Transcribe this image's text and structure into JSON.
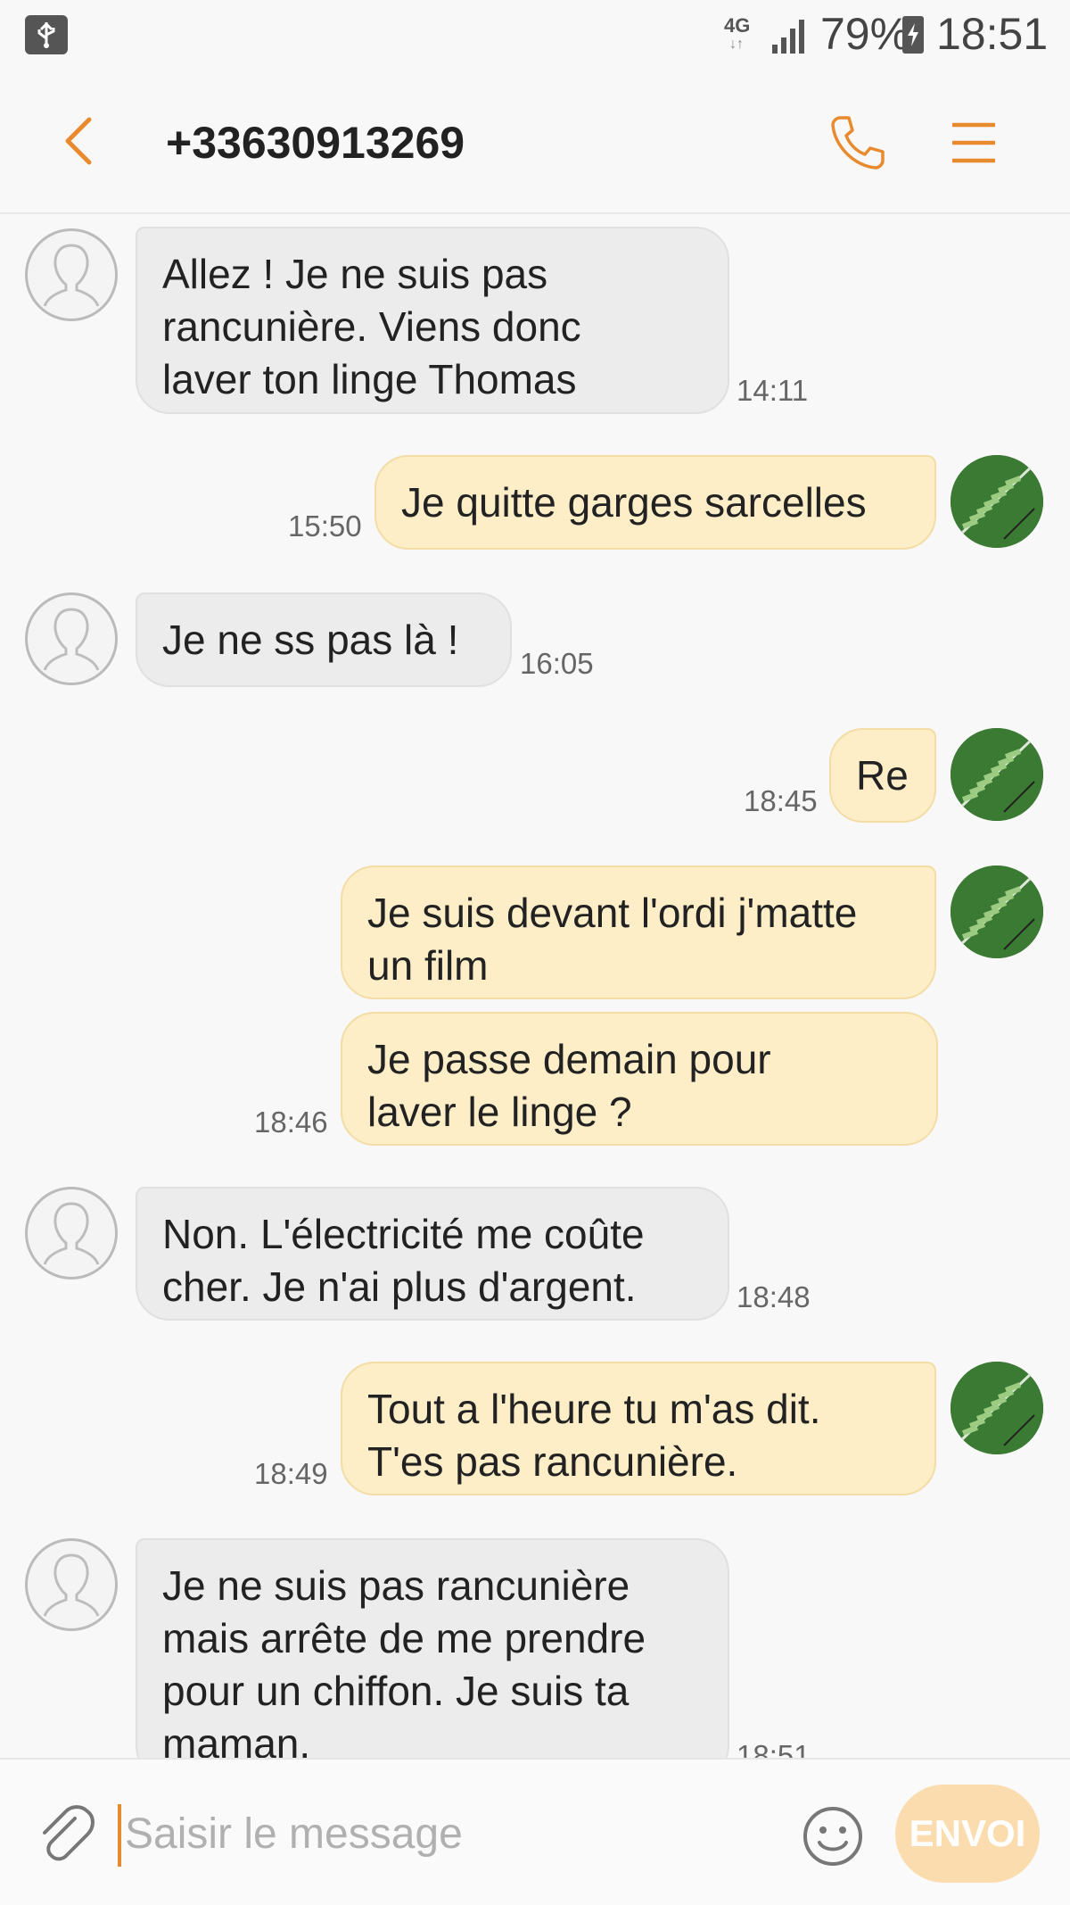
{
  "status_bar": {
    "network_type": "4G",
    "network_arrows": "↓↑",
    "battery_percent": "79%",
    "time": "18:51"
  },
  "header": {
    "title": "+33630913269"
  },
  "icons": {
    "back": "chevron-left-icon",
    "call": "phone-icon",
    "menu": "hamburger-menu-icon",
    "attach": "paperclip-icon",
    "emoji": "smiley-icon",
    "usb": "usb-icon"
  },
  "colors": {
    "accent": "#e88a2e",
    "incoming_bubble": "#ececec",
    "outgoing_bubble": "#fdeec8",
    "send_button": "#fbdcae"
  },
  "messages": [
    {
      "dir": "in",
      "lines": [
        "Allez ! Je ne suis pas",
        "rancunière. Viens donc",
        "laver ton linge Thomas"
      ],
      "time": "14:11"
    },
    {
      "dir": "out",
      "lines": [
        "Je quitte garges sarcelles"
      ],
      "time": "15:50"
    },
    {
      "dir": "in",
      "lines": [
        "Je ne ss pas là !"
      ],
      "time": "16:05"
    },
    {
      "dir": "out",
      "lines": [
        "Re"
      ],
      "time": "18:45"
    },
    {
      "dir": "out",
      "lines": [
        "Je suis devant l'ordi j'matte",
        "un film"
      ],
      "time": ""
    },
    {
      "dir": "out",
      "lines": [
        "Je passe demain pour",
        "laver le linge ?"
      ],
      "time": "18:46"
    },
    {
      "dir": "in",
      "lines": [
        "Non. L'électricité me coûte",
        "cher. Je n'ai plus d'argent."
      ],
      "time": "18:48"
    },
    {
      "dir": "out",
      "lines": [
        "Tout a l'heure tu m'as dit.",
        "T'es pas rancunière."
      ],
      "time": "18:49"
    },
    {
      "dir": "in",
      "lines": [
        "Je ne suis pas rancunière",
        "mais arrête de me prendre",
        "pour un chiffon. Je suis ta",
        "maman."
      ],
      "time": "18:51"
    }
  ],
  "composer": {
    "placeholder": "Saisir le message",
    "value": "",
    "send_label": "ENVOI"
  }
}
